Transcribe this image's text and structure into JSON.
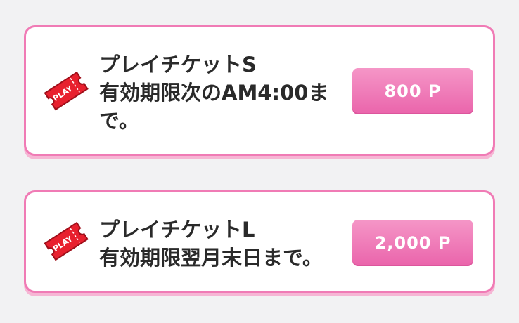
{
  "tickets": [
    {
      "name": "プレイチケットS",
      "validity_line1": "有効期限次のAM4:00ま",
      "validity_line2": "で。",
      "price": "800 P",
      "icon": "play-ticket-icon",
      "icon_text": "PLAY"
    },
    {
      "name": "プレイチケットL",
      "validity_line1": "有効期限翌月末日まで。",
      "price": "2,000 P",
      "icon": "play-ticket-icon",
      "icon_text": "PLAY"
    }
  ],
  "colors": {
    "background": "#f2f2f3",
    "card_border": "#f07bb5",
    "button_top": "#f596c7",
    "button_bottom": "#ea64ab",
    "ticket_red": "#e8202e"
  }
}
